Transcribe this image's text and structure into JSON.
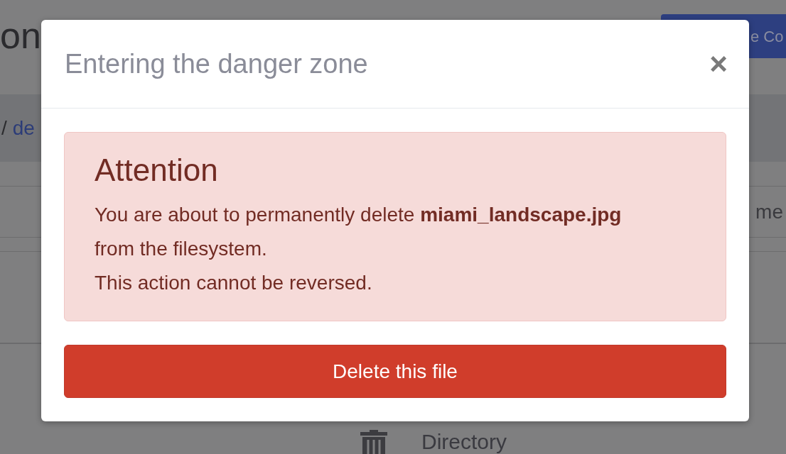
{
  "background": {
    "page_title": "on",
    "top_button": "e Co",
    "breadcrumb_separator": "/",
    "breadcrumb_link": "de",
    "column_header": "me",
    "row_type": "Directory"
  },
  "modal": {
    "title": "Entering the danger zone",
    "close": "×",
    "alert": {
      "heading": "Attention",
      "lines": [
        "You are about to permanently delete **miami_landscape.jpg** from the filesystem.",
        "This action cannot be reversed."
      ]
    },
    "confirm_button": "Delete this file"
  }
}
